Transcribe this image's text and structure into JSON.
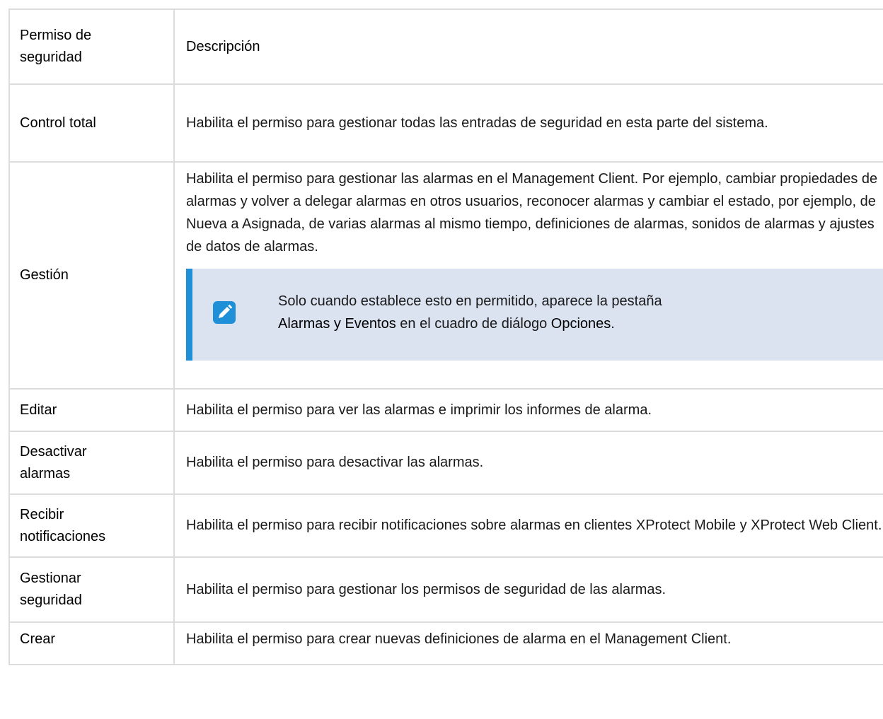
{
  "header": {
    "col1": "Permiso de seguridad",
    "col2": "Descripción"
  },
  "rows": [
    {
      "name": "Control total",
      "desc": "Habilita el permiso para gestionar todas las entradas de seguridad en esta parte del sistema."
    },
    {
      "name": "Gestión",
      "desc": "Habilita el permiso para gestionar las alarmas en el Management Client. Por ejemplo, cambiar propiedades de alarmas y volver a delegar alarmas en otros usuarios, reconocer alarmas y cambiar el estado, por ejemplo, de Nueva a Asignada, de varias alarmas al mismo tiempo, definiciones de alarmas, sonidos de alarmas y ajustes de datos de alarmas."
    },
    {
      "name": "Editar",
      "desc": "Habilita el permiso para ver las alarmas e imprimir los informes de alarma."
    },
    {
      "name": "Desactivar alarmas",
      "desc": "Habilita el permiso para desactivar las alarmas."
    },
    {
      "name": "Recibir notificaciones",
      "desc": "Habilita el permiso para recibir notificaciones sobre alarmas en clientes XProtect Mobile y XProtect Web Client."
    },
    {
      "name": "Gestionar seguridad",
      "desc": "Habilita el permiso para gestionar los permisos de seguridad de las alarmas."
    },
    {
      "name": "Crear",
      "desc": "Habilita el permiso para crear nuevas definiciones de alarma en el Management Client."
    }
  ],
  "note": {
    "icon": "pencil-icon",
    "line1": "Solo cuando establece esto en permitido, aparece la pestaña",
    "bold1": "Alarmas y Eventos",
    "mid": " en el cuadro de diálogo ",
    "bold2": "Opciones",
    "end": "."
  },
  "colors": {
    "accent": "#1f8fd8",
    "note_bg": "#dbe3f1",
    "border": "#dcdcdc"
  }
}
